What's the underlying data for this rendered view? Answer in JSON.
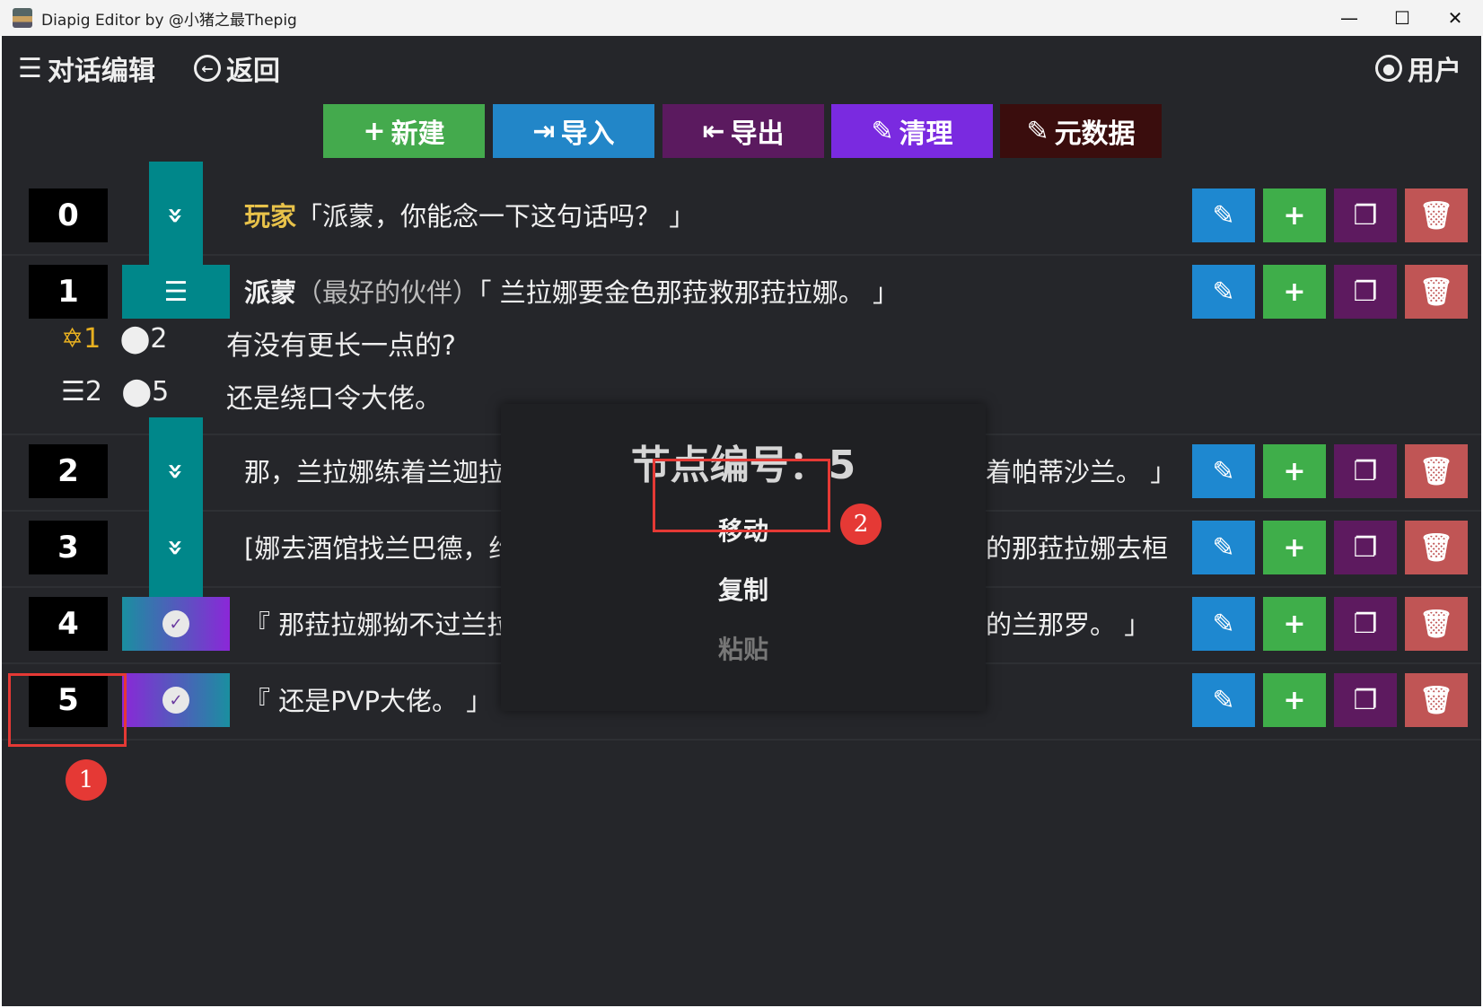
{
  "window": {
    "title": "Diapig Editor by @小猪之最Thepig",
    "minimize": "—",
    "maximize": "☐",
    "close": "✕"
  },
  "header": {
    "menu_label": "对话编辑",
    "back_label": "返回",
    "user_label": "用户"
  },
  "toolbar": {
    "new": {
      "icon": "+",
      "label": "新建",
      "color": "#44aa4d"
    },
    "import": {
      "icon": "⇥",
      "label": "导入",
      "color": "#2286c8"
    },
    "export": {
      "icon": "⇤",
      "label": "导出",
      "color": "#5b1a5f"
    },
    "clean": {
      "icon": "✎",
      "label": "清理",
      "color": "#7a2ae0"
    },
    "metadata": {
      "icon": "✎",
      "label": "元数据",
      "color": "#3a0d0d"
    }
  },
  "rows": [
    {
      "index": "0",
      "type_icon": "»",
      "speaker": "玩家",
      "text": "「派蒙，你能念一下这句话吗？ 」"
    },
    {
      "index": "1",
      "type_icon": "☰",
      "speaker": "派蒙",
      "note": "（最好的伙伴）",
      "text": "「 兰拉娜要金色那菈救那菈拉娜。 」",
      "options": [
        {
          "icon": "✡",
          "a": "1",
          "b": "2",
          "text": "有没有更长一点的?"
        },
        {
          "icon": "☰",
          "a": "2",
          "b": "5",
          "text": "还是绕口令大佬。"
        }
      ]
    },
    {
      "index": "2",
      "type_icon": "»",
      "text_left": "那，兰拉娜练着兰迦拉",
      "text_right": "着帕蒂沙兰。 」"
    },
    {
      "index": "3",
      "type_icon": "»",
      "text_left": "[娜去酒馆找兰巴德，约",
      "text_right": "的那菈拉娜去桓"
    },
    {
      "index": "4",
      "type_icon": "✓",
      "text_left": "『 那菈拉娜拗不过兰拉",
      "text_right": "的兰那罗。 」"
    },
    {
      "index": "5",
      "type_icon": "✓",
      "text": "『 还是PVP大佬。 」"
    }
  ],
  "row_actions": {
    "edit": "✎",
    "add": "+",
    "copy": "❐",
    "delete": "🗑"
  },
  "popup": {
    "title": "节点编号：5",
    "items": [
      "移动",
      "复制",
      "粘贴"
    ]
  },
  "annotations": {
    "badge1": "1",
    "badge2": "2"
  }
}
